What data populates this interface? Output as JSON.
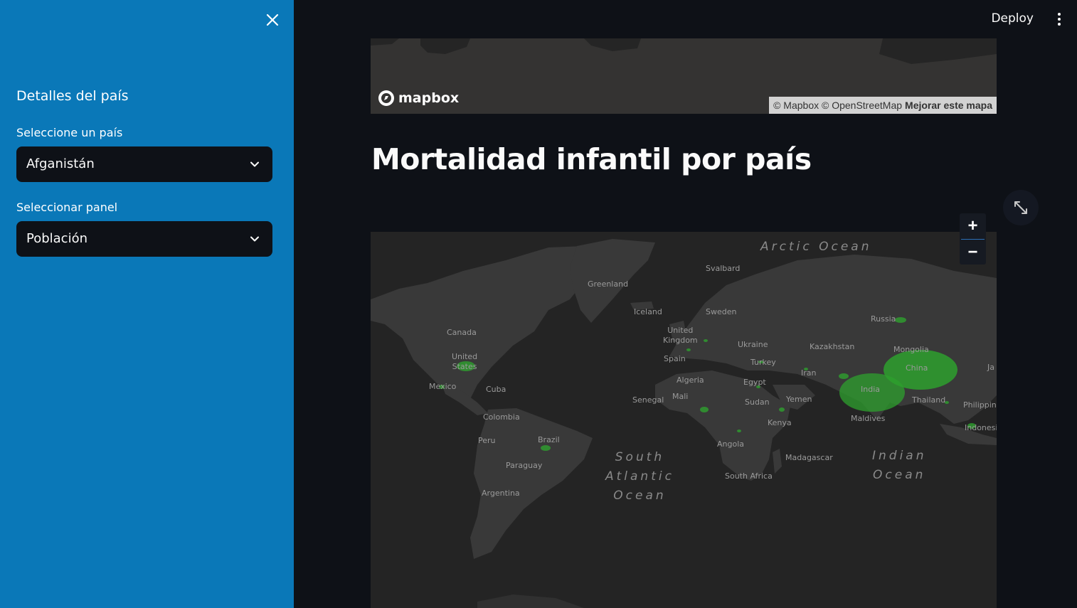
{
  "sidebar": {
    "close_icon": "close-icon",
    "title": "Detalles del país",
    "country_label": "Seleccione un país",
    "country_value": "Afganistán",
    "panel_label": "Seleccionar panel",
    "panel_value": "Población"
  },
  "header": {
    "deploy_label": "Deploy",
    "menu_icon": "vertical-dots-icon"
  },
  "map_top": {
    "logo_text": "mapbox",
    "attribution": "© Mapbox © OpenStreetMap",
    "improve_link": "Mejorar este mapa"
  },
  "main": {
    "title": "Mortalidad infantil por país",
    "fullscreen_icon": "expand-icon"
  },
  "map_main": {
    "zoom_in": "+",
    "zoom_out": "−",
    "oceans": {
      "arctic": "Arctic Ocean",
      "south_atlantic": "South\nAtlantic\nOcean",
      "indian": "Indian\nOcean"
    },
    "labels": {
      "svalbard": "Svalbard",
      "greenland": "Greenland",
      "iceland": "Iceland",
      "sweden": "Sweden",
      "russia": "Russia",
      "canada": "Canada",
      "united_kingdom": "United\nKingdom",
      "ukraine": "Ukraine",
      "kazakhstan": "Kazakhstan",
      "mongolia": "Mongolia",
      "united_states": "United\nStates",
      "spain": "Spain",
      "turkey": "Turkey",
      "china": "China",
      "japan": "Ja",
      "iran": "Iran",
      "mexico": "Mexico",
      "cuba": "Cuba",
      "algeria": "Algeria",
      "egypt": "Egypt",
      "india": "India",
      "mali": "Mali",
      "senegal": "Senegal",
      "sudan": "Sudan",
      "yemen": "Yemen",
      "thailand": "Thailand",
      "philippines": "Philippin",
      "colombia": "Colombia",
      "maldives": "Maldives",
      "kenya": "Kenya",
      "indonesia": "Indonesi",
      "brazil": "Brazil",
      "peru": "Peru",
      "angola": "Angola",
      "madagascar": "Madagascar",
      "paraguay": "Paraguay",
      "south_africa": "South Africa",
      "argentina": "Argentina"
    },
    "bubble_color": "#2ea02e"
  },
  "colors": {
    "sidebar_bg": "#0a78b8",
    "app_bg": "#0e1117",
    "map_bg": "#242424",
    "land": "#3a3a3a"
  }
}
